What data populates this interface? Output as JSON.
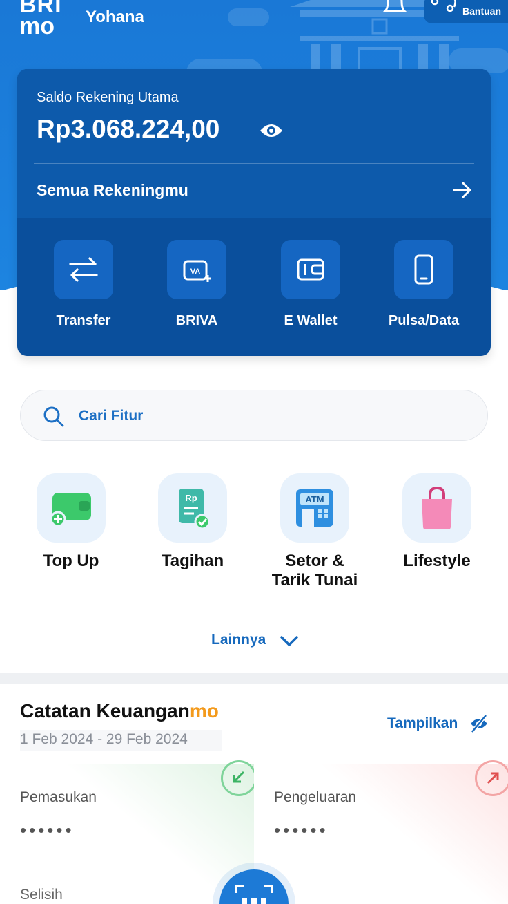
{
  "header": {
    "logo_top": "BRI",
    "logo_bottom": "mo",
    "username": "Yohana",
    "help_label": "Bantuan"
  },
  "balance": {
    "label": "Saldo Rekening Utama",
    "amount": "Rp3.068.224,00",
    "all_accounts": "Semua Rekeningmu"
  },
  "quick_actions": [
    {
      "label": "Transfer",
      "icon": "transfer-icon"
    },
    {
      "label": "BRIVA",
      "icon": "va-icon"
    },
    {
      "label": "E Wallet",
      "icon": "wallet-icon"
    },
    {
      "label": "Pulsa/Data",
      "icon": "phone-icon"
    }
  ],
  "search": {
    "placeholder": "Cari Fitur"
  },
  "features": [
    {
      "label": "Top Up",
      "icon": "topup-wallet-icon"
    },
    {
      "label": "Tagihan",
      "icon": "bill-icon"
    },
    {
      "label": "Setor &",
      "label2": "Tarik Tunai",
      "icon": "atm-icon"
    },
    {
      "label": "Lifestyle",
      "icon": "shopping-bag-icon"
    }
  ],
  "more_label": "Lainnya",
  "finance": {
    "title": "Catatan Keuangan",
    "title_suffix": "mo",
    "date_range": "1 Feb 2024 - 29 Feb 2024",
    "show_label": "Tampilkan",
    "income_label": "Pemasukan",
    "income_value": "••••••",
    "expense_label": "Pengeluaran",
    "expense_value": "••••••",
    "diff_label": "Selisih"
  },
  "colors": {
    "primary": "#1a78d6",
    "card": "#0a4f9c",
    "accent_orange": "#f39a1c",
    "link_blue": "#1669bd"
  }
}
